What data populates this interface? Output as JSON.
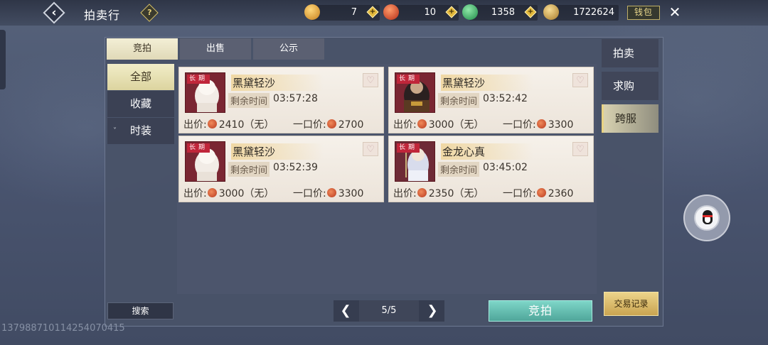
{
  "header": {
    "title": "拍卖行",
    "help": "?",
    "close": "✕",
    "wallet_label": "钱包",
    "currencies": [
      {
        "name": "gold-token",
        "value": "7",
        "color": "#e0a23a"
      },
      {
        "name": "red-jade",
        "value": "10",
        "color": "#d84a2a"
      },
      {
        "name": "green-jade",
        "value": "1358",
        "color": "#3fb56a"
      },
      {
        "name": "gold-ingot",
        "value": "1722624",
        "color": "#d5a84a"
      }
    ]
  },
  "tabs": [
    "竞拍",
    "出售",
    "公示"
  ],
  "categories": [
    "全部",
    "收藏",
    "时装"
  ],
  "right_tabs": [
    "拍卖",
    "求购",
    "跨服"
  ],
  "items": [
    {
      "badge": "长期",
      "name": "黑黛轻沙",
      "time_label": "剩余时间",
      "time": "03:57:28",
      "bid_label": "出价:",
      "bid": "2410（无）",
      "buy_label": "一口价:",
      "buy": "2700"
    },
    {
      "badge": "长期",
      "name": "黑黛轻沙",
      "time_label": "剩余时间",
      "time": "03:52:42",
      "bid_label": "出价:",
      "bid": "3000（无）",
      "buy_label": "一口价:",
      "buy": "3300"
    },
    {
      "badge": "长期",
      "name": "黑黛轻沙",
      "time_label": "剩余时间",
      "time": "03:52:39",
      "bid_label": "出价:",
      "bid": "3000（无）",
      "buy_label": "一口价:",
      "buy": "3300"
    },
    {
      "badge": "长期",
      "name": "金龙心真",
      "time_label": "剩余时间",
      "time": "03:45:02",
      "bid_label": "出价:",
      "bid": "2350（无）",
      "buy_label": "一口价:",
      "buy": "2360"
    }
  ],
  "footer": {
    "search": "搜索",
    "page": "5/5",
    "auction": "竞拍",
    "trade_record": "交易记录"
  },
  "uid": "13798871011425407041​5"
}
